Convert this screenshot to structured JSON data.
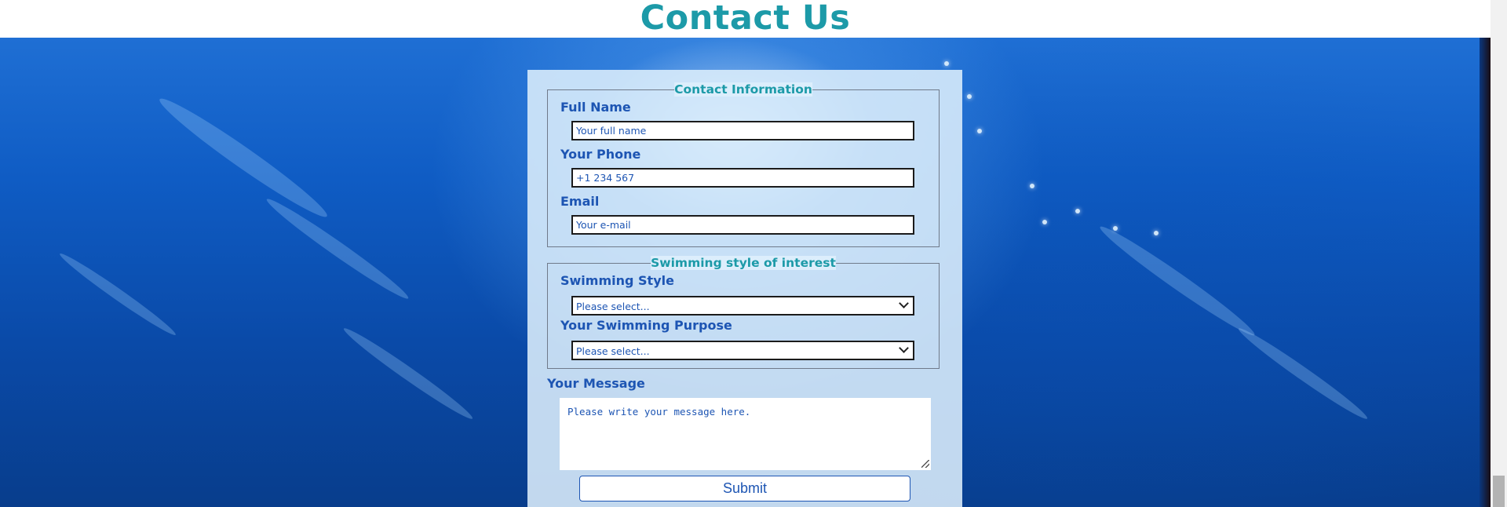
{
  "page": {
    "title": "Contact Us"
  },
  "contact_info": {
    "legend": "Contact Information",
    "full_name": {
      "label": "Full Name",
      "placeholder": "Your full name"
    },
    "phone": {
      "label": "Your Phone",
      "placeholder": "+1 234 567"
    },
    "email": {
      "label": "Email",
      "placeholder": "Your e-mail"
    }
  },
  "swimming": {
    "legend": "Swimming style of interest",
    "style": {
      "label": "Swimming Style",
      "selected": "Please select..."
    },
    "purpose": {
      "label": "Your Swimming Purpose",
      "selected": "Please select..."
    }
  },
  "message": {
    "label": "Your Message",
    "placeholder": "Please write your message here."
  },
  "submit": {
    "label": "Submit"
  },
  "icons": {
    "dropdown": "chevron-down-icon",
    "resize": "resize-grip-icon"
  },
  "colors": {
    "title": "#1c9aa8",
    "label": "#1d55b3",
    "legend": "#1c9aa8"
  }
}
